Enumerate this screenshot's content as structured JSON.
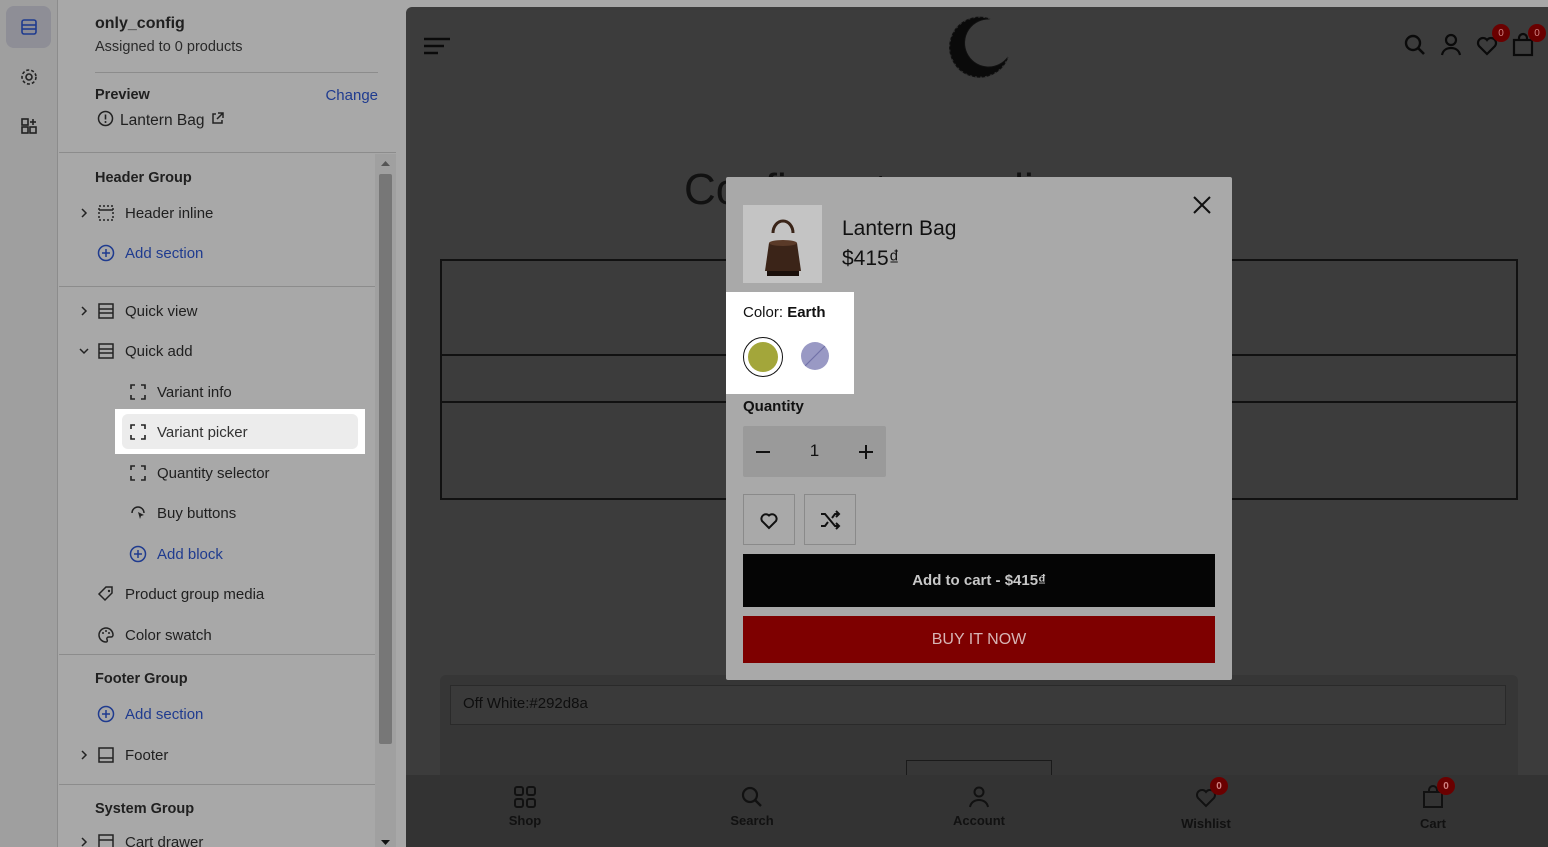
{
  "config": {
    "name": "only_config",
    "subtitle": "Assigned to 0 products",
    "preview_label": "Preview",
    "change_label": "Change",
    "preview_product": "Lantern Bag"
  },
  "tree": {
    "header_group": {
      "title": "Header Group",
      "header_inline": "Header inline",
      "add_section": "Add section"
    },
    "quick_view": "Quick view",
    "quick_add": "Quick add",
    "blocks": {
      "variant_info": "Variant info",
      "variant_picker": "Variant picker",
      "quantity_selector": "Quantity selector",
      "buy_buttons": "Buy buttons",
      "add_block": "Add block"
    },
    "product_group_media": "Product group media",
    "color_swatch": "Color swatch",
    "footer_group": {
      "title": "Footer Group",
      "add_section": "Add section",
      "footer": "Footer"
    },
    "system_group": {
      "title": "System Group",
      "cart_drawer": "Cart drawer"
    }
  },
  "store": {
    "bg_title": "Configurator media",
    "swatch_input": "Off White:#292d8a",
    "wishlist_count": "0",
    "cart_count": "0",
    "nav": [
      "Shop",
      "Search",
      "Account",
      "Wishlist",
      "Cart"
    ]
  },
  "modal": {
    "product_title": "Lantern Bag",
    "price": "$415₫",
    "color_label": "Color:",
    "color_value": "Earth",
    "quantity_label": "Quantity",
    "quantity": "1",
    "add_to_cart": "Add to cart - $415₫",
    "buy_now": "BUY IT NOW"
  },
  "colors": {
    "swatch_earth": "#a3a63a",
    "swatch_lavender": "#9999c4",
    "buy_button": "#7e0000",
    "link": "#1f3b8f"
  }
}
